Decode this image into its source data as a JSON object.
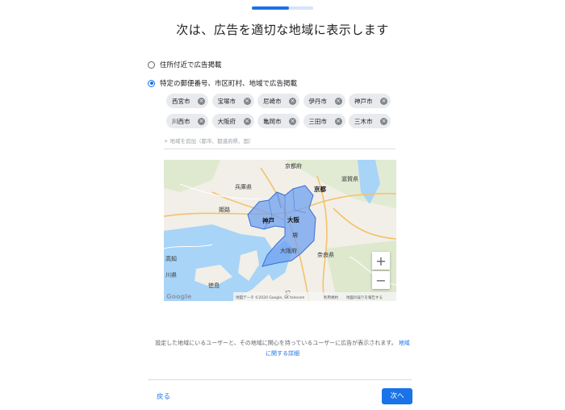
{
  "progress": {
    "fraction": 0.6
  },
  "title": "次は、広告を適切な地域に表示します",
  "location_options": [
    {
      "label": "住所付近で広告掲載",
      "selected": false
    },
    {
      "label": "特定の郵便番号、市区町村、地域で広告掲載",
      "selected": true
    }
  ],
  "chips": [
    "西宮市",
    "宝塚市",
    "尼崎市",
    "伊丹市",
    "神戸市",
    "川西市",
    "大阪府",
    "亀岡市",
    "三田市",
    "三木市"
  ],
  "add_placeholder": "+ 地域を追加（都市、都道府県、国）",
  "map": {
    "labels": {
      "kyoto_fu": "京都府",
      "shiga": "滋賀県",
      "hyogo": "兵庫県",
      "kyoto": "京都",
      "himeji": "姫路",
      "kobe": "神戸",
      "osaka": "大阪",
      "sakai": "堺",
      "osaka_fu": "大阪府",
      "nara": "奈良県",
      "tokushima": "徳島",
      "kochi_ken": "高知",
      "kagawa_ken": "川県",
      "kii": "紀"
    },
    "logo": "Google",
    "attribution": "地図データ ©2020 Google, SK telecom",
    "terms": "利用規約",
    "report": "地図の誤りを報告する",
    "zoom_in": "+",
    "zoom_out": "−"
  },
  "footer": {
    "note": "設定した地域にいるユーザーと、その地域に関心を持っているユーザーに広告が表示されます。",
    "link": "地域に関する詳細"
  },
  "buttons": {
    "back": "戻る",
    "next": "次へ"
  }
}
